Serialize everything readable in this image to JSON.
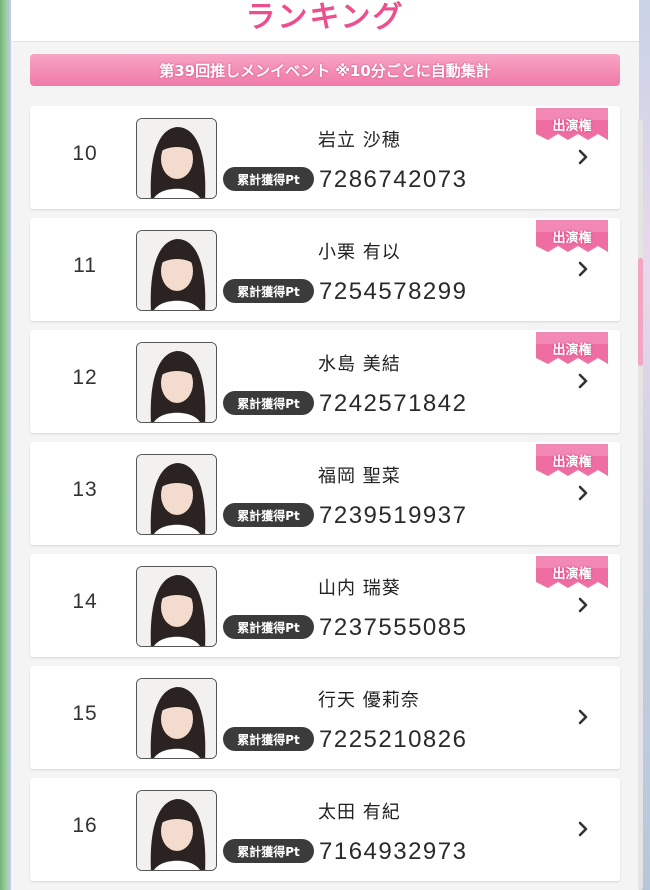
{
  "header": {
    "title": "ランキング"
  },
  "banner": {
    "text": "第39回推しメンイベント ※10分ごとに自動集計"
  },
  "labels": {
    "pt_badge": "累計獲得Pt",
    "tag": "出演権"
  },
  "colors": {
    "accent": "#ec4f8e",
    "banner": "#f07aa9",
    "badge": "#3b3b3b"
  },
  "ranking": [
    {
      "rank": "10",
      "name": "岩立 沙穂",
      "points": "7286742073",
      "has_tag": true
    },
    {
      "rank": "11",
      "name": "小栗 有以",
      "points": "7254578299",
      "has_tag": true
    },
    {
      "rank": "12",
      "name": "水島 美結",
      "points": "7242571842",
      "has_tag": true
    },
    {
      "rank": "13",
      "name": "福岡 聖菜",
      "points": "7239519937",
      "has_tag": true
    },
    {
      "rank": "14",
      "name": "山内 瑞葵",
      "points": "7237555085",
      "has_tag": true
    },
    {
      "rank": "15",
      "name": "行天 優莉奈",
      "points": "7225210826",
      "has_tag": false
    },
    {
      "rank": "16",
      "name": "太田 有紀",
      "points": "7164932973",
      "has_tag": false
    }
  ]
}
